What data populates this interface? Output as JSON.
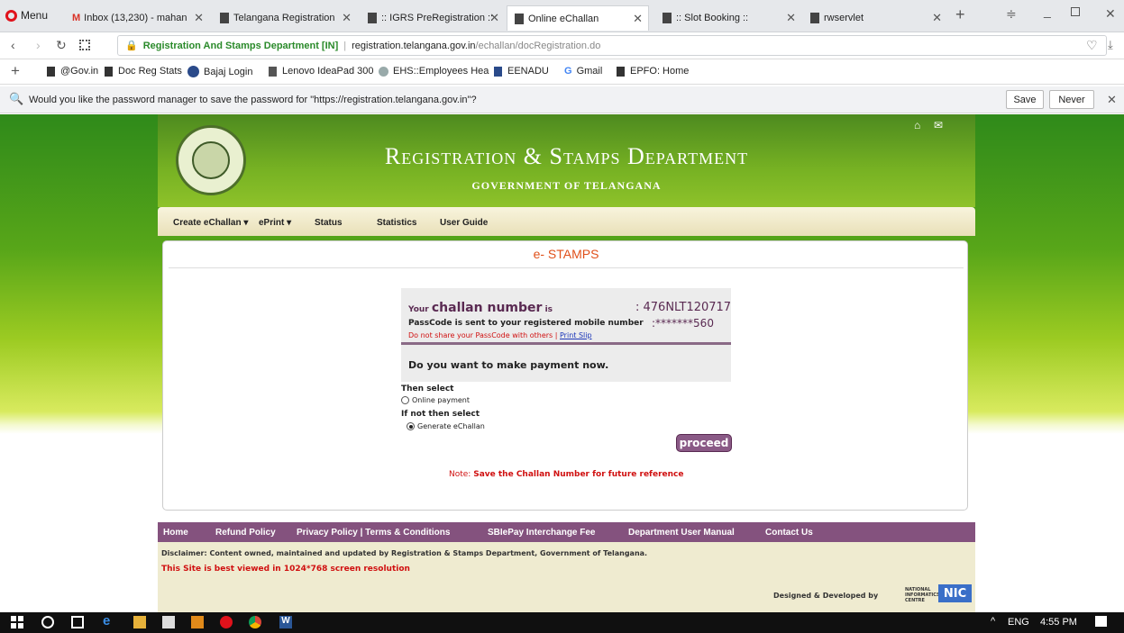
{
  "browser": {
    "menu_label": "Menu",
    "tabs": [
      {
        "label": "Inbox (13,230) - mahan"
      },
      {
        "label": "Telangana Registration"
      },
      {
        "label": ":: IGRS PreRegistration ::"
      },
      {
        "label": "Online eChallan"
      },
      {
        "label": ":: Slot Booking ::"
      },
      {
        "label": "rwservlet"
      }
    ],
    "url": {
      "site_name": "Registration And Stamps Department [IN]",
      "host": "registration.telangana.gov.in",
      "path": "/echallan/docRegistration.do"
    },
    "bookmarks": [
      "@Gov.in",
      "Doc Reg Stats",
      "Bajaj Login",
      "Lenovo IdeaPad 300",
      "EHS::Employees Hea",
      "EENADU",
      "Gmail",
      "EPFO: Home"
    ],
    "password_prompt": {
      "message": "Would you like the password manager to save the password for \"https://registration.telangana.gov.in\"?",
      "save": "Save",
      "never": "Never"
    }
  },
  "site": {
    "title": "Registration & Stamps Department",
    "subtitle": "GOVERNMENT OF TELANGANA",
    "menu": [
      "Create eChallan",
      "ePrint",
      "Status",
      "Statistics",
      "User Guide"
    ],
    "panel_title": "e- STAMPS",
    "challan": {
      "label_prefix": "Your",
      "label_emph": "challan number",
      "label_suffix": "is",
      "value": ": 476NLT120717",
      "passcode_label": "PassCode is sent to your registered mobile number",
      "passcode_value": ":*******560",
      "warning": "Do not share your PassCode with others |",
      "print_slip": "Print Slip",
      "question": "Do you want to make payment now."
    },
    "options": {
      "then_select": "Then select",
      "online_payment": "Online payment",
      "if_not": "If not then select",
      "generate": "Generate eChallan"
    },
    "proceed": "proceed",
    "note_label": "Note:",
    "note_text": "Save the Challan Number for future reference",
    "footer_links": [
      "Home",
      "Refund Policy",
      "Privacy Policy | Terms & Conditions",
      "SBIePay Interchange Fee",
      "Department User Manual",
      "Contact Us"
    ],
    "disclaimer": "Disclaimer: Content owned, maintained and updated by Registration & Stamps Department, Government of Telangana.",
    "best_viewed": "This Site is best viewed in 1024*768 screen resolution",
    "designed_by": "Designed & Developed by",
    "nic": "NIC",
    "nic_small": "NATIONAL INFORMATICS CENTRE"
  },
  "taskbar": {
    "lang": "ENG",
    "time": "4:55 PM"
  },
  "colors": {
    "accent_purple": "#84527e",
    "estamps_orange": "#e0501a",
    "proceed_bg": "#8a5a86"
  }
}
